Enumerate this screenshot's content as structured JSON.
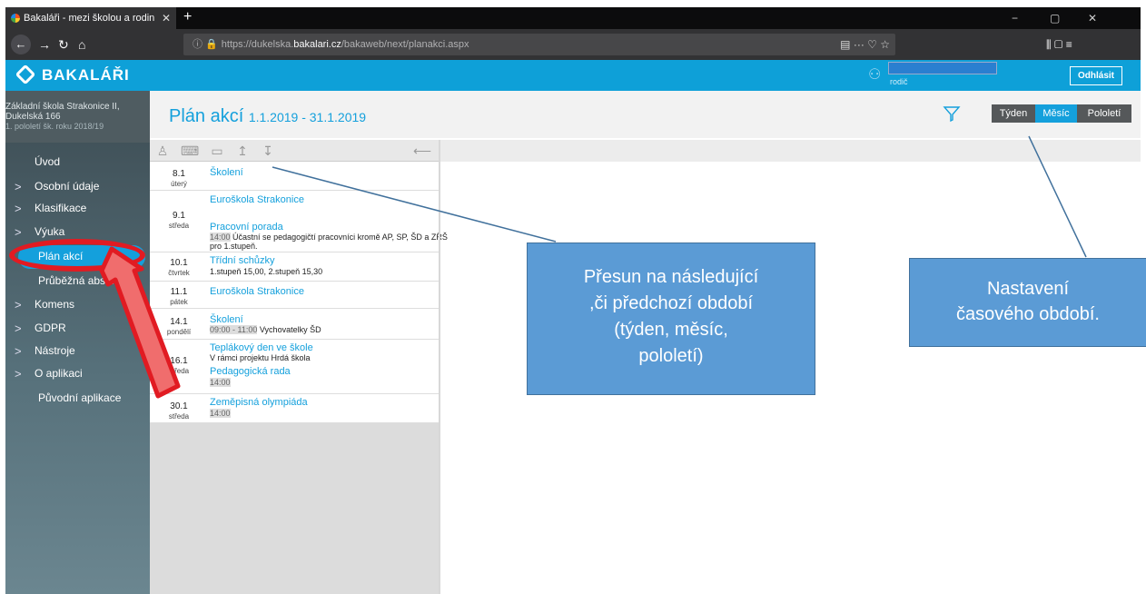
{
  "browser": {
    "tab_title": "Bakaláři - mezi školou a rodin",
    "tab_close": "✕",
    "new_tab": "+",
    "url_prefix": "https://dukelska.",
    "url_host": "bakalari.cz",
    "url_path": "/bakaweb/next/planakci.aspx",
    "url_icons": "▤  ···  ♡  ☆",
    "right_icons": "⫼   ▢   ≡",
    "win_min": "−",
    "win_max": "▢",
    "win_close": "✕"
  },
  "header": {
    "logo_text": "BAKALÁŘI",
    "user_role": "rodič",
    "logout_label": "Odhlásit",
    "accent": "#0ea0d8"
  },
  "school": {
    "line1": "Základní škola Strakonice II,",
    "line2": "Dukelská 166",
    "semester": "1. pololetí šk. roku 2018/19"
  },
  "menu": [
    {
      "chev": "",
      "label": "Úvod"
    },
    {
      "chev": ">",
      "label": "Osobní údaje"
    },
    {
      "chev": ">",
      "label": "Klasifikace"
    },
    {
      "chev": ">",
      "label": "Výuka"
    },
    {
      "chev": "",
      "label": "Plán akcí",
      "active": true
    },
    {
      "chev": "",
      "label": "Průběžná absence"
    },
    {
      "chev": ">",
      "label": "Komens"
    },
    {
      "chev": ">",
      "label": "GDPR"
    },
    {
      "chev": ">",
      "label": "Nástroje"
    },
    {
      "chev": ">",
      "label": "O aplikaci"
    },
    {
      "chev": "",
      "label": "Původní aplikace"
    }
  ],
  "page": {
    "title": "Plán akcí",
    "range": "1.1.2019 - 31.1.2019",
    "seg_week": "Týden",
    "seg_month": "Měsíc",
    "seg_semester": "Pololetí",
    "collapse_icon": "⟵"
  },
  "events": {
    "d1": {
      "date": "8.1",
      "dow": "úterý",
      "title": "Školení"
    },
    "d2": {
      "date": "9.1",
      "dow": "středa",
      "t1": "Euroškola Strakonice",
      "t2": "Pracovní porada",
      "time2": "14:00",
      "note2a": "Účastní se pedagogičtí pracovníci kromě AP, SP, ŠD a ZŘŠ",
      "note2b": "pro 1.stupeň."
    },
    "d3": {
      "date": "10.1",
      "dow": "čtvrtek",
      "title": "Třídní schůzky",
      "note": "1.stupeň 15,00, 2.stupeň 15,30"
    },
    "d4": {
      "date": "11.1",
      "dow": "pátek",
      "title": "Euroškola Strakonice"
    },
    "d5": {
      "date": "14.1",
      "dow": "pondělí",
      "title": "Školení",
      "time": "09:00 - 11:00",
      "note": "Vychovatelky ŠD"
    },
    "d6": {
      "date": "16.1",
      "dow": "středa",
      "t1": "Teplákový den ve škole",
      "n1": "V rámci projektu Hrdá škola",
      "t2": "Pedagogická rada",
      "time2": "14:00"
    },
    "d7": {
      "date": "30.1",
      "dow": "středa",
      "title": "Zeměpisná olympiáda",
      "time": "14:00"
    }
  },
  "callouts": {
    "one_l1": "Přesun na následující",
    "one_l2": ",či předchozí období",
    "one_l3": "(týden, měsíc,",
    "one_l4": "pololetí)",
    "two_l1": "Nastavení",
    "two_l2": "časového období."
  },
  "colors": {
    "annotation_red": "#e11b22",
    "callout_blue": "#5b9bd5"
  }
}
